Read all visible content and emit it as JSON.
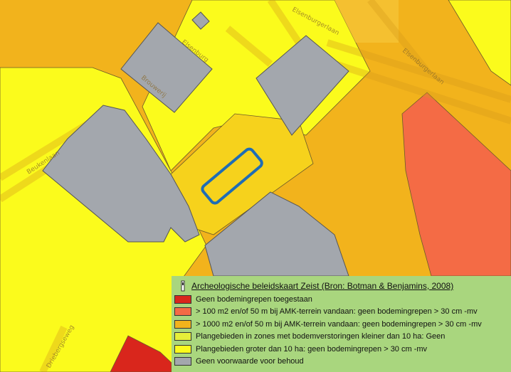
{
  "map": {
    "street_labels": [
      "Beukenlaan",
      "Brouwerij",
      "Elsenburgerlaan",
      "Elsenburg",
      "Elsenburgerlaan",
      "Driebergseweg"
    ]
  },
  "legend": {
    "title": "Archeologische beleidskaart Zeist (Bron: Botman & Benjamins, 2008)",
    "items": [
      {
        "label": "Geen bodemingrepen toegestaan",
        "color": "#d9261c"
      },
      {
        "label": "> 100 m2 en/of 50 m bij AMK-terrein vandaan: geen bodemingrepen > 30 cm -mv",
        "color": "#f46b45"
      },
      {
        "label": "> 1000 m2 en/of 50 m bij AMK-terrein vandaan: geen bodemingrepen > 30 cm -mv",
        "color": "#f2b31c"
      },
      {
        "label": "Plangebieden in zones met bodemverstoringen kleiner dan 10 ha: Geen",
        "color": "#e6ef3a"
      },
      {
        "label": "Plangebieden groter dan 10 ha: geen bodemingrepen > 30 cm -mv",
        "color": "#fbfb1c"
      },
      {
        "label": "Geen voorwaarde voor behoud",
        "color": "#a3a7ad"
      }
    ]
  },
  "plan_area": {
    "stroke_color": "#1f6db5"
  }
}
